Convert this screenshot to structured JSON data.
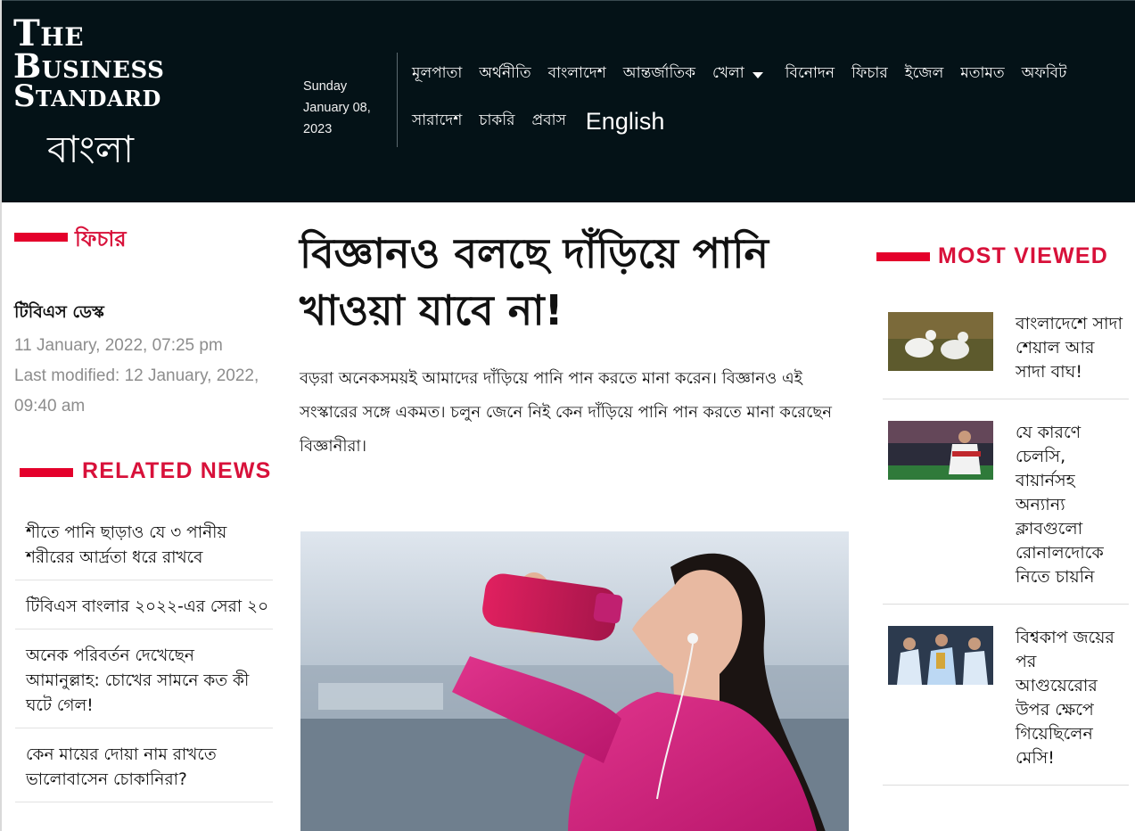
{
  "brand": {
    "logo_line1": "The",
    "logo_line2": "Business",
    "logo_line3": "Standard",
    "logo_bangla": "বাংলা",
    "accent_color": "#e4002b",
    "header_bg": "#041217"
  },
  "header": {
    "day": "Sunday",
    "date": "January 08,",
    "year": "2023"
  },
  "nav": {
    "row1": [
      "মূলপাতা",
      "অর্থনীতি",
      "বাংলাদেশ",
      "আন্তর্জাতিক",
      "খেলা",
      "বিনোদন",
      "ফিচার",
      "ইজেল",
      "মতামত",
      "অফবিট"
    ],
    "row2": [
      "সারাদেশ",
      "চাকরি",
      "প্রবাস",
      "English"
    ],
    "dropdown_icon": "caret-down-icon"
  },
  "left": {
    "section_label": "ফিচার",
    "author": "টিবিএস ডেস্ক",
    "published": "11 January, 2022, 07:25 pm",
    "modified": "Last modified: 12 January, 2022, 09:40 am",
    "related_title": "RELATED NEWS",
    "related": [
      "শীতে পানি ছাড়াও যে ৩ পানীয় শরীরের আর্দ্রতা ধরে রাখবে",
      "টিবিএস বাংলার ২০২২-এর সেরা ২০",
      "অনেক পরিবর্তন দেখেছেন আমানুল্লাহ: চোখের সামনে কত কী ঘটে গেল!",
      "কেন মায়ের দোয়া নাম রাখতে ভালোবাসেন চোকানিরা?"
    ]
  },
  "article": {
    "headline": "বিজ্ঞানও বলছে দাঁড়িয়ে পানি খাওয়া যাবে না!",
    "summary": "বড়রা অনেকসময়ই আমাদের দাঁড়িয়ে পানি পান করতে মানা করেন। বিজ্ঞানও এই সংস্কারের সঙ্গে একমত। চলুন জেনে নিই কেন দাঁড়িয়ে পানি পান করতে মানা করেছেন বিজ্ঞানীরা।",
    "hero_subject": "woman-drinking-from-water-bottle"
  },
  "most_viewed": {
    "title": "MOST VIEWED",
    "items": [
      {
        "title": "বাংলাদেশে সাদা শেয়াল আর সাদা বাঘ!",
        "thumb": "white-fox-photo"
      },
      {
        "title": "যে কারণে চেলসি, বায়ার্নসহ অন্যান্য ক্লাবগুলো রোনালদোকে নিতে চায়নি",
        "thumb": "footballer-photo"
      },
      {
        "title": "বিশ্বকাপ জয়ের পর আগুয়েরোর উপর ক্ষেপে গিয়েছিলেন মেসি!",
        "thumb": "trophy-celebration-photo"
      }
    ]
  }
}
